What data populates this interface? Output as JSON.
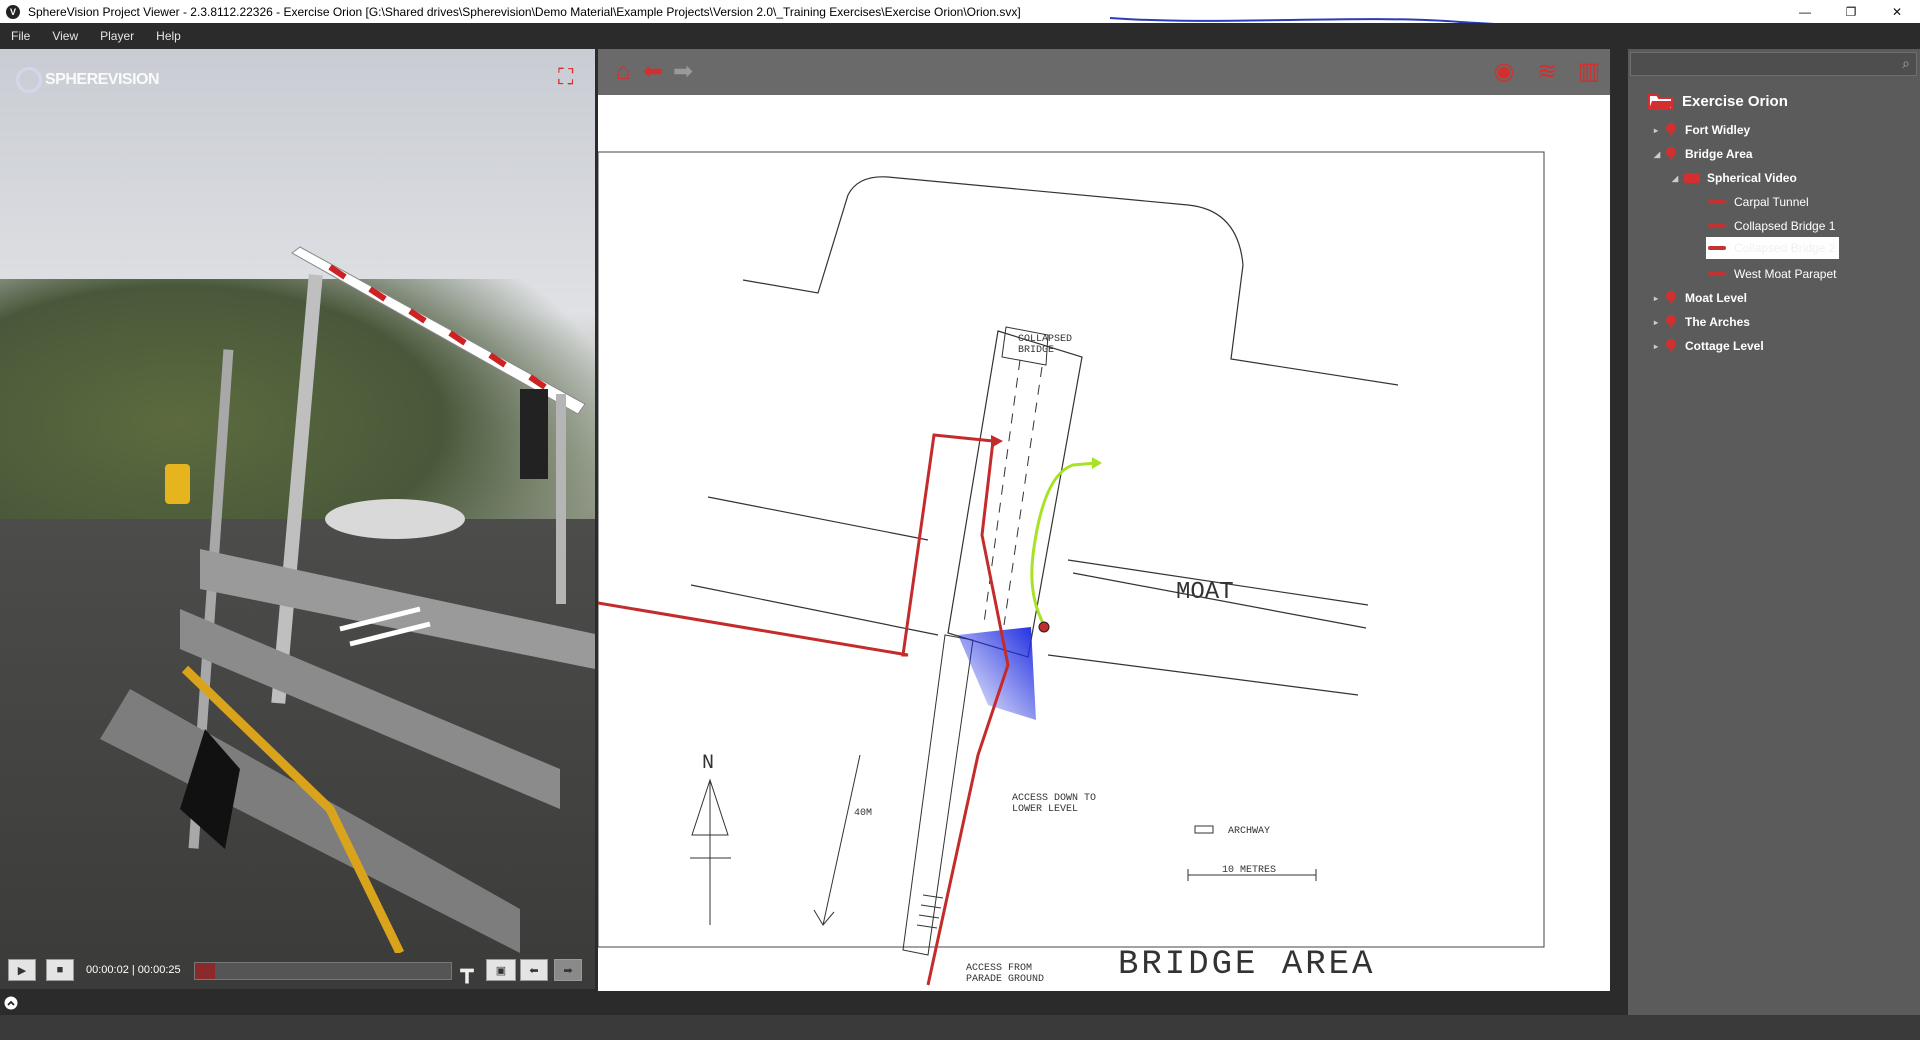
{
  "window": {
    "title": "SphereVision Project Viewer - 2.3.8112.22326 - Exercise Orion [G:\\Shared drives\\Spherevision\\Demo Material\\Example Projects\\Version 2.0\\_Training Exercises\\Exercise Orion\\Orion.svx]",
    "minimize": "—",
    "restore": "❐",
    "close": "✕"
  },
  "menu": [
    "File",
    "View",
    "Player",
    "Help"
  ],
  "video": {
    "logo_text": "SPHEREVISION",
    "time": "00:00:02 | 00:00:25",
    "progress_fraction": 0.08
  },
  "map": {
    "labels": {
      "collapsed_bridge": [
        "COLLAPSED",
        "BRIDGE"
      ],
      "moat": "MOAT",
      "north": "N",
      "distance": "40M",
      "access_down": [
        "ACCESS DOWN TO",
        "LOWER LEVEL"
      ],
      "archway": "ARCHWAY",
      "scale": "10 METRES",
      "access_from": [
        "ACCESS FROM",
        "PARADE GROUND"
      ],
      "area_title": "BRIDGE AREA"
    },
    "colors": {
      "route": "#c42b2b",
      "path": "#a7e324",
      "view_cone": "#1f2de0"
    }
  },
  "tree": {
    "root": "Exercise Orion",
    "items": [
      {
        "label": "Fort Widley",
        "level": 1,
        "icon": "map-pin-icon",
        "expanded": false
      },
      {
        "label": "Bridge Area",
        "level": 1,
        "icon": "map-pin-icon",
        "expanded": true
      },
      {
        "label": "Spherical Video",
        "level": 2,
        "icon": "video-camera-icon",
        "expanded": true
      },
      {
        "label": "Carpal Tunnel",
        "level": 3,
        "icon": "video-path-icon"
      },
      {
        "label": "Collapsed Bridge 1",
        "level": 3,
        "icon": "video-path-icon"
      },
      {
        "label": "Collapsed Bridge 2",
        "level": 3,
        "icon": "video-path-icon",
        "selected": true
      },
      {
        "label": "West Moat Parapet",
        "level": 3,
        "icon": "video-path-icon"
      },
      {
        "label": "Moat Level",
        "level": 1,
        "icon": "map-pin-icon",
        "expanded": false
      },
      {
        "label": "The Arches",
        "level": 1,
        "icon": "map-pin-icon",
        "expanded": false
      },
      {
        "label": "Cottage Level",
        "level": 1,
        "icon": "map-pin-icon",
        "expanded": false
      }
    ]
  }
}
